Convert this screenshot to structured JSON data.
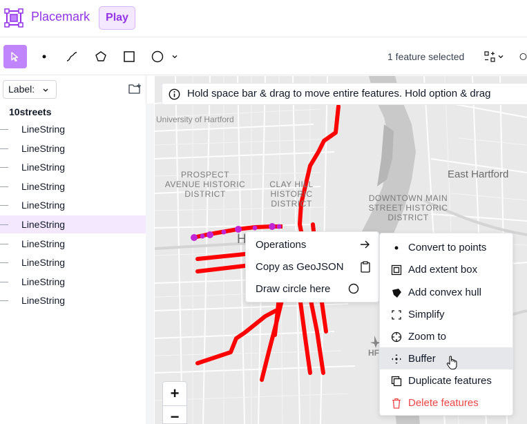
{
  "app": {
    "name": "Placemark",
    "play_label": "Play",
    "accent": "#9333ea"
  },
  "toolbar": {
    "tools": [
      {
        "name": "select",
        "icon": "cursor-arrow-icon",
        "active": true
      },
      {
        "name": "point",
        "icon": "point-icon"
      },
      {
        "name": "line",
        "icon": "line-icon"
      },
      {
        "name": "polygon",
        "icon": "polygon-icon"
      },
      {
        "name": "rectangle",
        "icon": "rectangle-icon"
      },
      {
        "name": "circle",
        "icon": "circle-icon"
      }
    ],
    "selection_status": "1 feature selected"
  },
  "sidebar": {
    "label_select": "Label:",
    "tree_title": "10streets",
    "items": [
      {
        "label": "LineString",
        "selected": false
      },
      {
        "label": "LineString",
        "selected": false
      },
      {
        "label": "LineString",
        "selected": false
      },
      {
        "label": "LineString",
        "selected": false
      },
      {
        "label": "LineString",
        "selected": false
      },
      {
        "label": "LineString",
        "selected": true
      },
      {
        "label": "LineString",
        "selected": false
      },
      {
        "label": "LineString",
        "selected": false
      },
      {
        "label": "LineString",
        "selected": false
      },
      {
        "label": "LineString",
        "selected": false
      }
    ]
  },
  "map": {
    "hint": "Hold space bar & drag to move entire features. Hold option & drag",
    "labels": {
      "university": "University of Hartford",
      "prospect": "PROSPECT AVENUE HISTORIC DISTRICT",
      "clay_hill": "CLAY HILL HISTORIC DISTRICT",
      "east_hartford": "East Hartford",
      "downtown": "DOWNTOWN MAIN STREET HISTORIC DISTRICT",
      "h_letter": "H",
      "hf": "HF"
    },
    "zoom_in": "+",
    "zoom_out": "−",
    "feature_color": "#ff0000",
    "selected_color": "#c026d3"
  },
  "context_menu": {
    "items": [
      {
        "label": "Operations",
        "icon": "arrow-right-icon"
      },
      {
        "label": "Copy as GeoJSON",
        "icon": "clipboard-icon"
      },
      {
        "label": "Draw circle here",
        "icon": "circle-outline-icon"
      }
    ]
  },
  "operations_menu": {
    "items": [
      {
        "label": "Convert to points",
        "icon": "dot-icon"
      },
      {
        "label": "Add extent box",
        "icon": "extent-box-icon"
      },
      {
        "label": "Add convex hull",
        "icon": "convex-hull-icon"
      },
      {
        "label": "Simplify",
        "icon": "simplify-icon"
      },
      {
        "label": "Zoom to",
        "icon": "crosshair-icon"
      },
      {
        "label": "Buffer",
        "icon": "buffer-icon",
        "hover": true
      },
      {
        "label": "Duplicate features",
        "icon": "duplicate-icon"
      },
      {
        "label": "Delete features",
        "icon": "trash-icon",
        "danger": true
      }
    ]
  }
}
